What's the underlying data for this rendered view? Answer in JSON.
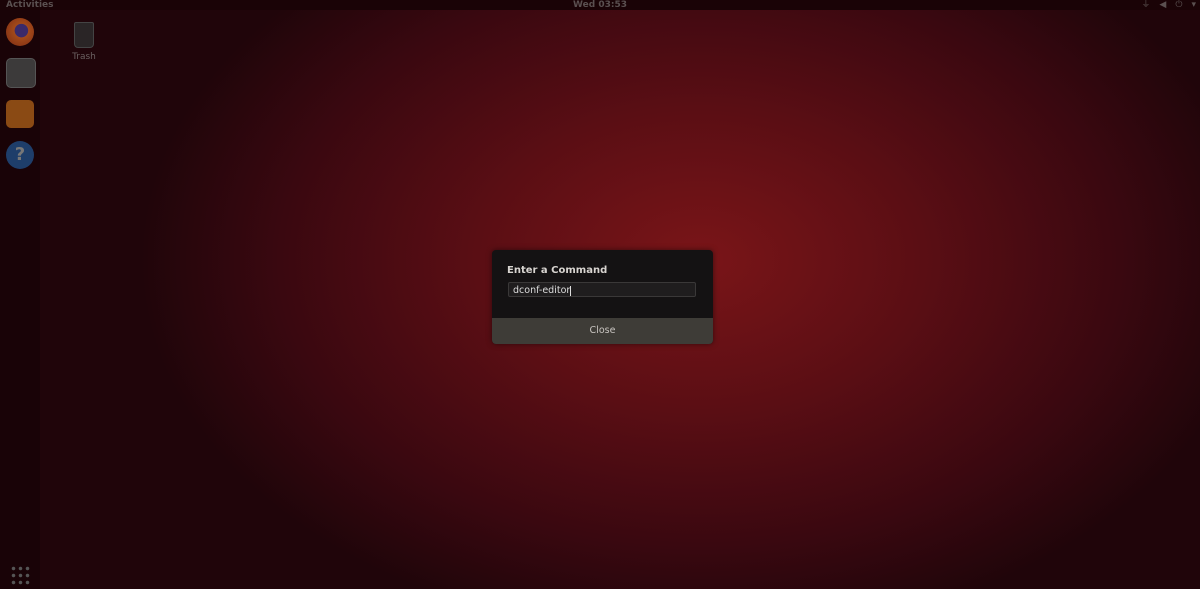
{
  "topbar": {
    "activities": "Activities",
    "clock": "Wed 03:53"
  },
  "tray": {
    "icons": [
      "network-icon",
      "volume-icon",
      "power-icon",
      "chevron-down-icon"
    ],
    "network": "⏚",
    "volume": "◀",
    "power": "⏻",
    "menu": "▾"
  },
  "dock": {
    "apps": [
      "firefox",
      "files",
      "software",
      "help"
    ],
    "help_glyph": "?"
  },
  "desktop": {
    "trash_label": "Trash"
  },
  "dialog": {
    "title": "Enter a Command",
    "input_value": "dconf-editor",
    "close_label": "Close"
  }
}
